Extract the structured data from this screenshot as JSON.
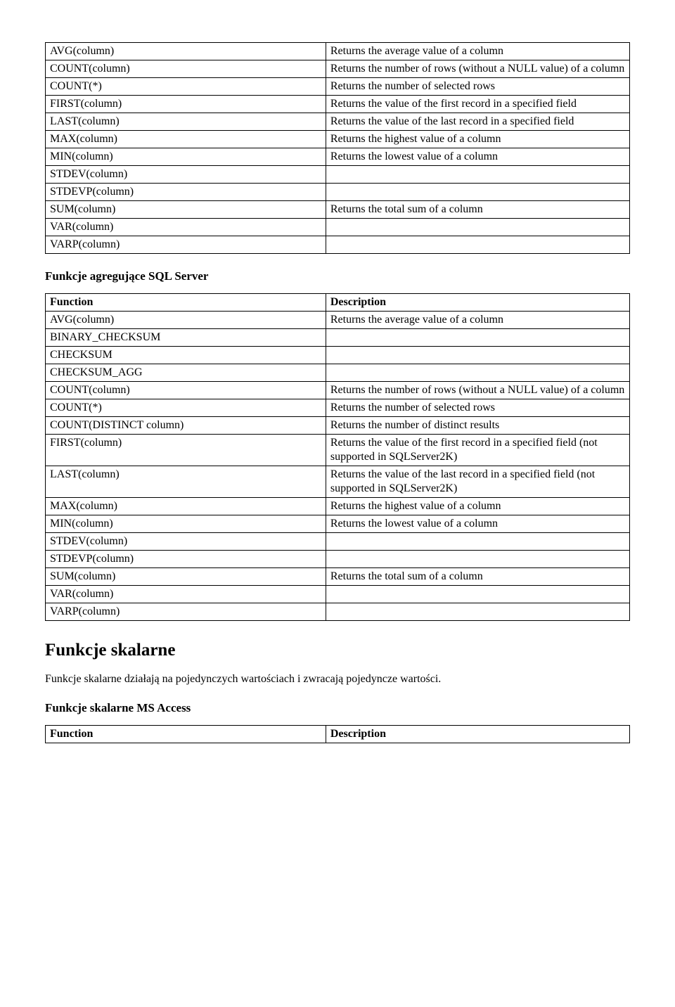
{
  "table1": {
    "rows": [
      {
        "fn": "AVG(column)",
        "desc": "Returns the average value of a column"
      },
      {
        "fn": "COUNT(column)",
        "desc": "Returns the number of rows (without a NULL value) of a column"
      },
      {
        "fn": "COUNT(*)",
        "desc": "Returns the number of selected rows"
      },
      {
        "fn": "FIRST(column)",
        "desc": "Returns the value of the first record in a specified field"
      },
      {
        "fn": "LAST(column)",
        "desc": "Returns the value of the last record in a specified field"
      },
      {
        "fn": "MAX(column)",
        "desc": "Returns the highest value of a column"
      },
      {
        "fn": "MIN(column)",
        "desc": "Returns the lowest value of a column"
      },
      {
        "fn": "STDEV(column)",
        "desc": ""
      },
      {
        "fn": "STDEVP(column)",
        "desc": ""
      },
      {
        "fn": "SUM(column)",
        "desc": "Returns the total sum of a column"
      },
      {
        "fn": "VAR(column)",
        "desc": ""
      },
      {
        "fn": "VARP(column)",
        "desc": ""
      }
    ]
  },
  "heading_aggregate_sqlserver": "Funkcje agregujące SQL Server",
  "table2": {
    "header": {
      "fn": "Function",
      "desc": "Description"
    },
    "rows": [
      {
        "fn": "AVG(column)",
        "desc": "Returns the average value of a column"
      },
      {
        "fn": "BINARY_CHECKSUM",
        "desc": ""
      },
      {
        "fn": "CHECKSUM",
        "desc": ""
      },
      {
        "fn": "CHECKSUM_AGG",
        "desc": ""
      },
      {
        "fn": "COUNT(column)",
        "desc": "Returns the number of rows (without a NULL value) of a column"
      },
      {
        "fn": "COUNT(*)",
        "desc": "Returns the number of selected rows"
      },
      {
        "fn": "COUNT(DISTINCT column)",
        "desc": "Returns the number of distinct results"
      },
      {
        "fn": "FIRST(column)",
        "desc": "Returns the value of the first record in a specified field (not supported in SQLServer2K)"
      },
      {
        "fn": "LAST(column)",
        "desc": "Returns the value of the last record in a specified field (not supported in SQLServer2K)"
      },
      {
        "fn": "MAX(column)",
        "desc": "Returns the highest value of a column"
      },
      {
        "fn": "MIN(column)",
        "desc": "Returns the lowest value of a column"
      },
      {
        "fn": "STDEV(column)",
        "desc": ""
      },
      {
        "fn": "STDEVP(column)",
        "desc": ""
      },
      {
        "fn": "SUM(column)",
        "desc": "Returns the total sum of a column"
      },
      {
        "fn": "VAR(column)",
        "desc": ""
      },
      {
        "fn": "VARP(column)",
        "desc": ""
      }
    ]
  },
  "heading_scalar": "Funkcje skalarne",
  "scalar_paragraph": "Funkcje skalarne działają na pojedynczych wartościach i zwracają pojedyncze wartości.",
  "heading_scalar_msaccess": "Funkcje skalarne MS Access",
  "table3": {
    "header": {
      "fn": "Function",
      "desc": "Description"
    }
  }
}
